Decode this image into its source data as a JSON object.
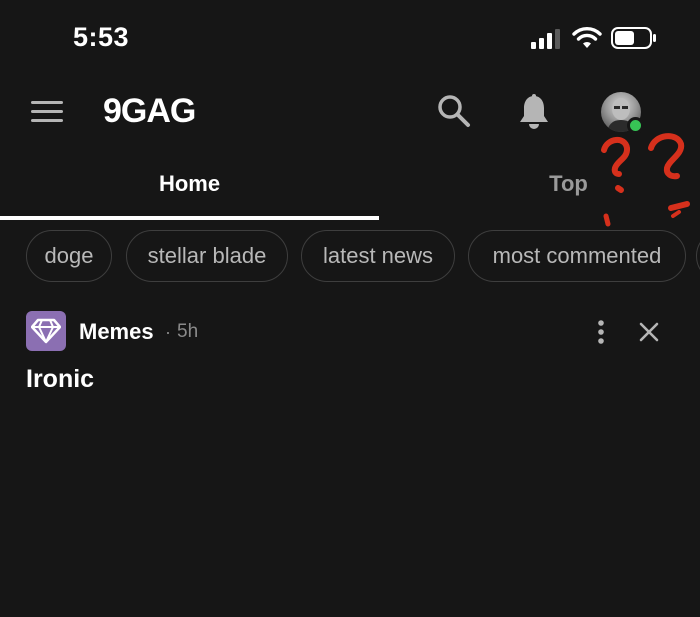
{
  "status_bar": {
    "time": "5:53",
    "icons": [
      "cellular-signal-icon",
      "wifi-icon",
      "battery-icon"
    ]
  },
  "header": {
    "logo": "9GAG",
    "icons": [
      "menu-icon",
      "search-icon",
      "bell-icon",
      "avatar"
    ]
  },
  "tabs": [
    {
      "label": "Home",
      "active": true
    },
    {
      "label": "Top",
      "active": false
    }
  ],
  "chips": [
    {
      "label": "doge"
    },
    {
      "label": "stellar blade"
    },
    {
      "label": "latest news"
    },
    {
      "label": "most commented"
    }
  ],
  "post": {
    "section": "Memes",
    "separator": "·",
    "time": "5h",
    "title": "Ironic"
  },
  "colors": {
    "background": "#161616",
    "online": "#37c455",
    "section_avatar": "#8b6fb2",
    "scribble": "#d6301c"
  }
}
